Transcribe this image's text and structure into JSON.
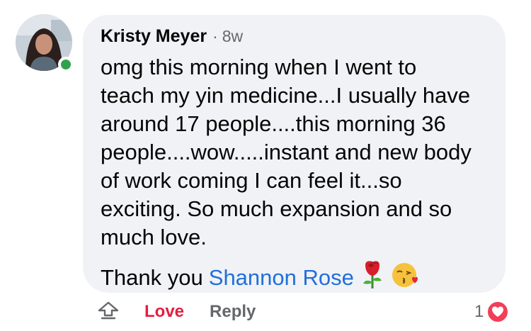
{
  "comment": {
    "author": "Kristy Meyer",
    "separator": "·",
    "time": "8w",
    "body": "omg this morning when I went to\nteach my yin medicine...I usually have\naround 17 people....this morning 36\npeople....wow.....instant and new body\nof work coming I can feel it...so\nexciting. So much expansion and so\nmuch love.",
    "thanks_text": "Thank you",
    "mention": "Shannon Rose",
    "emojis": [
      "rose-emoji",
      "kissing-face-emoji"
    ]
  },
  "avatar": {
    "online": true,
    "presence_color": "#31a24c"
  },
  "actions": {
    "love_label": "Love",
    "reply_label": "Reply"
  },
  "reactions": {
    "count": "1",
    "type": "heart-icon",
    "color": "#f33e58"
  },
  "colors": {
    "bubble": "#f0f2f5",
    "mention": "#216fdb",
    "love": "#e41e3f",
    "secondary_text": "#65676b"
  }
}
